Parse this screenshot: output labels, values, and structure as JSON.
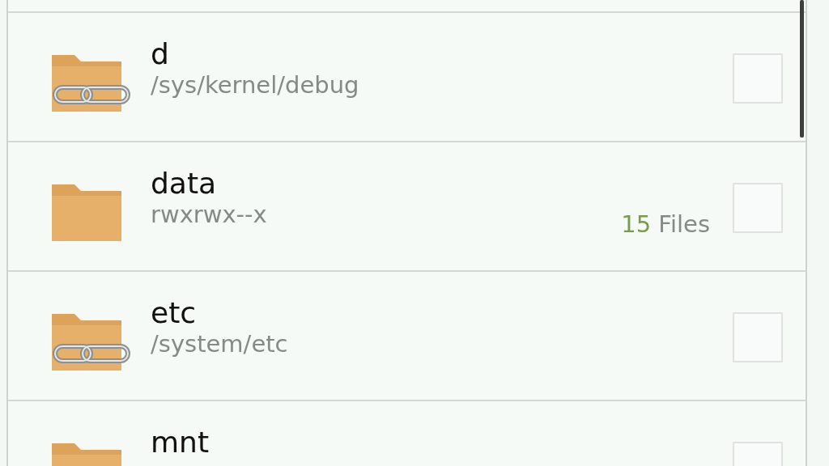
{
  "rows": [
    {
      "name": "d",
      "subtitle": "/sys/kernel/debug",
      "link": true,
      "checked": false
    },
    {
      "name": "data",
      "subtitle": "rwxrwx--x",
      "link": false,
      "file_count": "15",
      "count_label": "Files",
      "checked": false
    },
    {
      "name": "etc",
      "subtitle": "/system/etc",
      "link": true,
      "checked": false
    },
    {
      "name": "mnt",
      "checked": false
    }
  ]
}
